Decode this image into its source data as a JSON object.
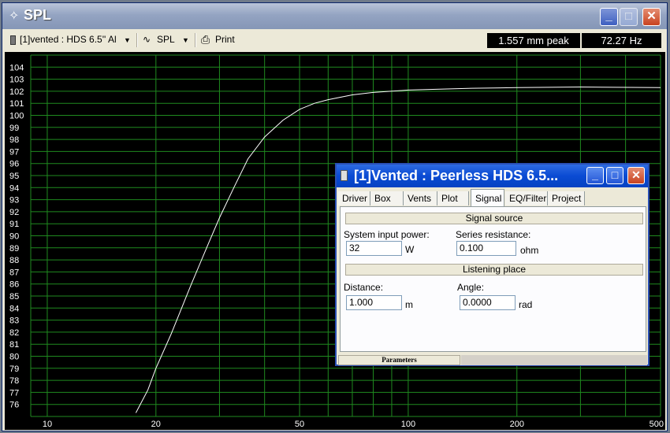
{
  "window": {
    "title": "SPL",
    "title_icon": "crosshair-icon"
  },
  "toolbar": {
    "project_label": "[1]vented : HDS 6.5'' Al",
    "view_label": "SPL",
    "print_label": "Print",
    "excursion_readout": "1.557 mm peak",
    "frequency_readout": "72.27 Hz"
  },
  "chart_data": {
    "type": "line",
    "x_scale": "log",
    "xlim": [
      9,
      500
    ],
    "ylim": [
      75,
      105
    ],
    "x_ticks": [
      "10",
      "20",
      "50",
      "100",
      "200",
      "500"
    ],
    "y_ticks": [
      "76",
      "77",
      "78",
      "79",
      "80",
      "81",
      "82",
      "83",
      "84",
      "85",
      "86",
      "87",
      "88",
      "89",
      "90",
      "91",
      "92",
      "93",
      "94",
      "95",
      "96",
      "97",
      "98",
      "99",
      "100",
      "101",
      "102",
      "103",
      "104"
    ],
    "grid": true,
    "series": [
      {
        "color": "#ffffff",
        "x": [
          17.6,
          19,
          20,
          22,
          25,
          28,
          30,
          33,
          36,
          40,
          45,
          50,
          55,
          60,
          70,
          80,
          100,
          150,
          200,
          300,
          500
        ],
        "y": [
          75.3,
          77.2,
          79.0,
          81.8,
          85.9,
          89.4,
          91.5,
          94.1,
          96.4,
          98.2,
          99.6,
          100.5,
          101.0,
          101.3,
          101.7,
          101.9,
          102.1,
          102.25,
          102.3,
          102.35,
          102.3
        ]
      }
    ],
    "colors": {
      "background": "#000000",
      "grid": "#1f8a1f",
      "curve": "#ffffff"
    }
  },
  "dialog": {
    "title": "[1]Vented : Peerless HDS 6.5...",
    "tabs": [
      {
        "label": "Driver"
      },
      {
        "label": "Box"
      },
      {
        "label": "Vents"
      },
      {
        "label": "Plot"
      },
      {
        "label": "Signal"
      },
      {
        "label": "EQ/Filter"
      },
      {
        "label": "Project"
      }
    ],
    "active_tab": "Signal",
    "signal_source": {
      "header": "Signal source",
      "power_label": "System input power:",
      "power_value": "32",
      "power_unit": "W",
      "resistance_label": "Series resistance:",
      "resistance_value": "0.100",
      "resistance_unit": "ohm"
    },
    "listening_place": {
      "header": "Listening place",
      "distance_label": "Distance:",
      "distance_value": "1.000",
      "distance_unit": "m",
      "angle_label": "Angle:",
      "angle_value": "0.0000",
      "angle_unit": "rad"
    },
    "status_label": "Parameters"
  }
}
